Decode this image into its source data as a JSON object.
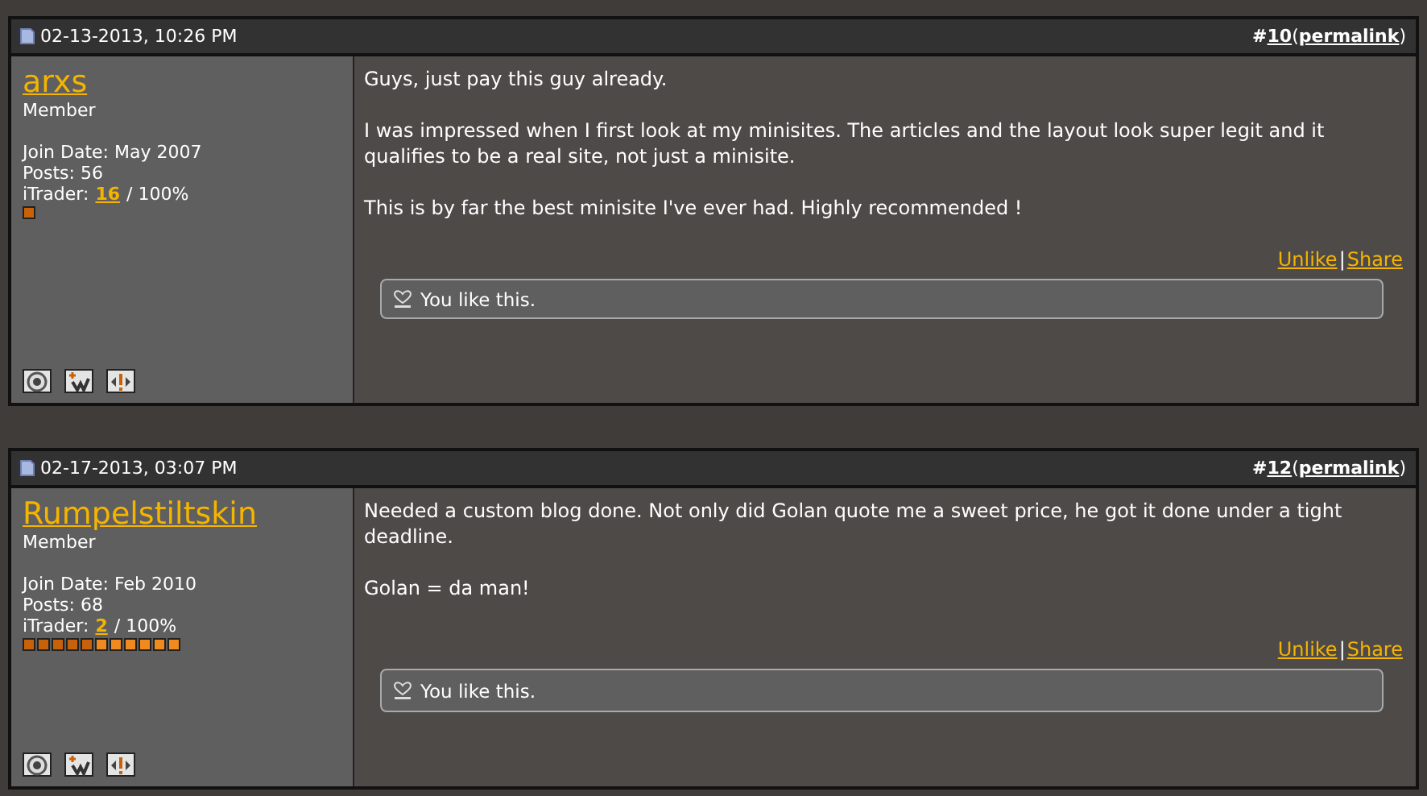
{
  "posts": [
    {
      "date": "02-13-2013, 10:26 PM",
      "hash": "#",
      "number": "10",
      "open_paren": "(",
      "permalink": "permalink",
      "close_paren": ")",
      "separator": "|",
      "username": "arxs",
      "title": "Member",
      "join_date": "Join Date: May 2007",
      "posts": "Posts: 56",
      "itrader_label": "iTrader:",
      "itrader_count": "16",
      "itrader_percent": "/ 100%",
      "pips": [
        {
          "color": "#c8620a"
        }
      ],
      "paragraphs": [
        "Guys, just pay this guy already.",
        "I was impressed when I first look at my minisites. The articles and the layout look super legit and it qualifies to be a real site, not just a minisite.",
        "This is by far the best minisite I've ever had. Highly recommended !"
      ],
      "unlike": "Unlike",
      "share": "Share",
      "likes": "You like this."
    },
    {
      "date": "02-17-2013, 03:07 PM",
      "hash": "#",
      "number": "12",
      "open_paren": "(",
      "permalink": "permalink",
      "close_paren": ")",
      "separator": "|",
      "username": "Rumpelstiltskin",
      "title": "Member",
      "join_date": "Join Date: Feb 2010",
      "posts": "Posts: 68",
      "itrader_label": "iTrader:",
      "itrader_count": "2",
      "itrader_percent": "/ 100%",
      "pips": [
        {
          "color": "#c8620a"
        },
        {
          "color": "#c8620a"
        },
        {
          "color": "#c8620a"
        },
        {
          "color": "#c8620a"
        },
        {
          "color": "#c8620a"
        },
        {
          "color": "#f08a1e"
        },
        {
          "color": "#f08a1e"
        },
        {
          "color": "#f08a1e"
        },
        {
          "color": "#f08a1e"
        },
        {
          "color": "#f08a1e"
        },
        {
          "color": "#f08a1e"
        }
      ],
      "paragraphs": [
        "Needed a custom blog done. Not only did Golan quote me a sweet price, he got it done under a tight deadline.",
        "Golan = da man!"
      ],
      "unlike": "Unlike",
      "share": "Share",
      "likes": "You like this."
    }
  ]
}
